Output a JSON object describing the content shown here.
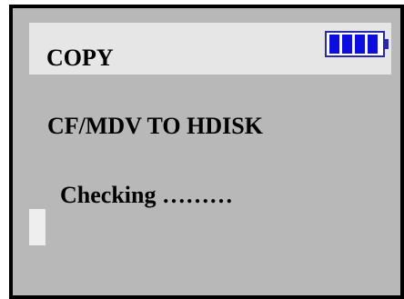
{
  "screen": {
    "title": "COPY",
    "operation": "CF/MDV TO HDISK",
    "status": "Checking ………"
  },
  "battery": {
    "icon": "battery-icon",
    "cells_filled": 4,
    "cells_total": 4,
    "color": "#0d0de0"
  },
  "colors": {
    "screen_bg": "#b8b8b8",
    "title_bar_bg": "#e6e6e6",
    "progress_fill": "#eeeeee"
  }
}
